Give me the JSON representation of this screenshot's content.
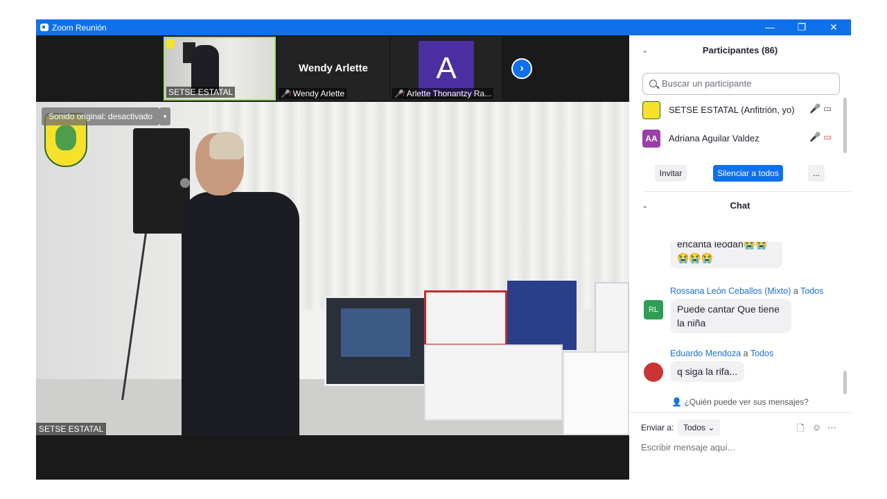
{
  "window": {
    "title": "Zoom Reunión",
    "controls": {
      "minimize": "—",
      "restore": "❐",
      "close": "✕"
    }
  },
  "thumbnails": [
    {
      "name": "SETSE ESTATAL",
      "active": true
    },
    {
      "name": "Wendy  Arlette",
      "display": "Wendy  Arlette",
      "muted": true
    },
    {
      "name": "Arlette Thonantzy Ra...",
      "avatar_letter": "A",
      "avatar_color": "#4b2ea0",
      "muted": true
    }
  ],
  "next_icon": "›",
  "video": {
    "audio_status": "Sonido original: desactivado",
    "audio_caret": "▾",
    "speaker_name": "SETSE ESTATAL"
  },
  "participants": {
    "chevron": "⌄",
    "title": "Participantes (86)",
    "search_placeholder": "Buscar un participante",
    "list": [
      {
        "name": "SETSE ESTATAL (Anfitrión, yo)",
        "mic": "🎤",
        "cam": "▭"
      },
      {
        "initials": "AA",
        "avatar_color": "#9a3ea8",
        "name": "Adriana Aguilar Valdez",
        "mic": "🎤",
        "cam": "▭"
      }
    ],
    "buttons": {
      "invite": "Invitar",
      "mute_all": "Silenciar a todos",
      "more": "..."
    }
  },
  "chat": {
    "chevron": "⌄",
    "title": "Chat",
    "messages": [
      {
        "text": "encanta leodan😭😭",
        "line2": "😭😭😭"
      },
      {
        "sender": "Rossana León Ceballos (Mixto)",
        "to_word": "a",
        "to": "Todos",
        "initials": "RL",
        "avatar_color": "#2e9e55",
        "text": "Puede cantar Que tiene",
        "line2": "la niña"
      },
      {
        "sender": "Eduardo Mendoza",
        "to_word": "a",
        "to": "Todos",
        "text": "q siga la rifa..."
      }
    ],
    "who_can_see": "¿Quién puede ver sus mensajes?",
    "send_to_label": "Enviar a:",
    "send_to_value": "Todos",
    "tools": {
      "file": "🗋",
      "emoji": "☺",
      "more": "···"
    },
    "input_placeholder": "Escribir mensaje aquí..."
  }
}
